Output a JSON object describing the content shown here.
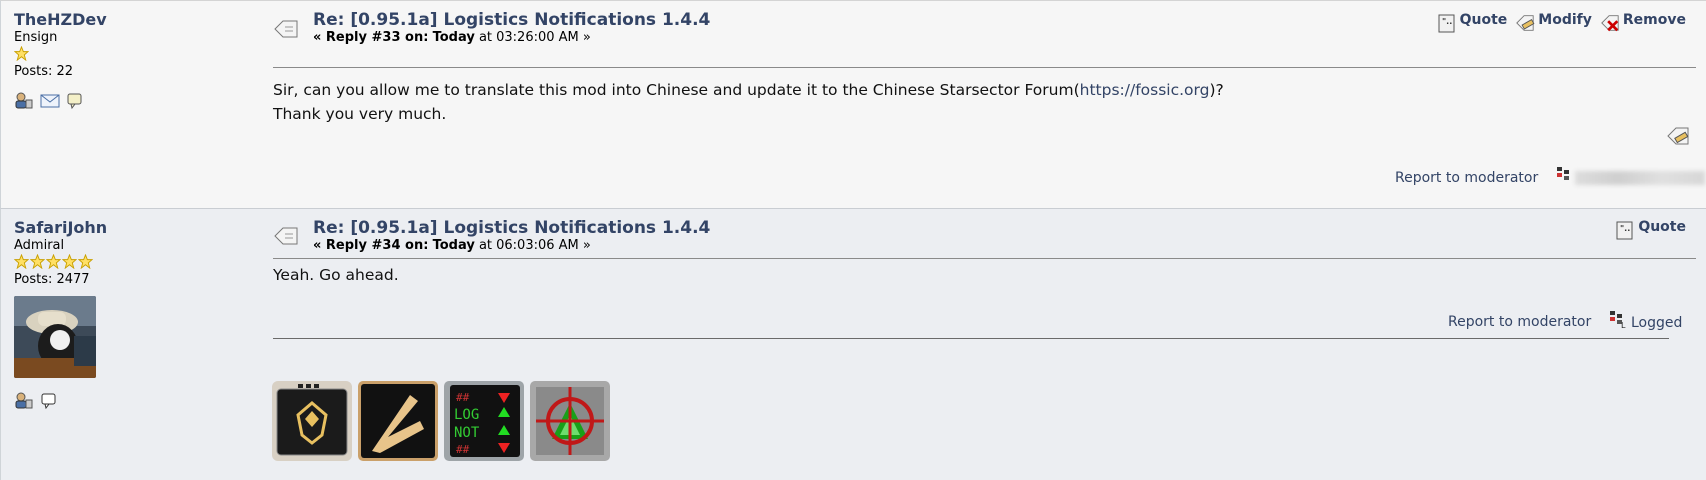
{
  "posts": [
    {
      "poster": {
        "name": "TheHZDev",
        "rank": "Ensign",
        "stars": 1,
        "posts_label": "Posts: 22"
      },
      "subject": "Re: [0.95.1a] Logistics Notifications 1.4.4",
      "reply_label": "« Reply #33 on:",
      "reply_day": "Today",
      "reply_time": "at 03:26:00 AM »",
      "actions": {
        "quote": "Quote",
        "modify": "Modify",
        "remove": "Remove"
      },
      "body": {
        "line1_prefix": "Sir, can you allow me to translate this mod into Chinese and update it to the Chinese Starsector Forum(",
        "link": "https://fossic.org",
        "line1_suffix": ")?",
        "line2": "Thank you very much."
      },
      "report": "Report to moderator"
    },
    {
      "poster": {
        "name": "SafariJohn",
        "rank": "Admiral",
        "stars": 5,
        "posts_label": "Posts: 2477"
      },
      "subject": "Re: [0.95.1a] Logistics Notifications 1.4.4",
      "reply_label": "« Reply #34 on:",
      "reply_day": "Today",
      "reply_time": "at 06:03:06 AM »",
      "actions": {
        "quote": "Quote"
      },
      "body": {
        "line1": "Yeah. Go ahead."
      },
      "report": "Report to moderator",
      "logged": "Logged"
    }
  ],
  "colors": {
    "link": "#334466",
    "post1_bg": "#f6f6f6",
    "post2_bg": "#eceef2"
  }
}
